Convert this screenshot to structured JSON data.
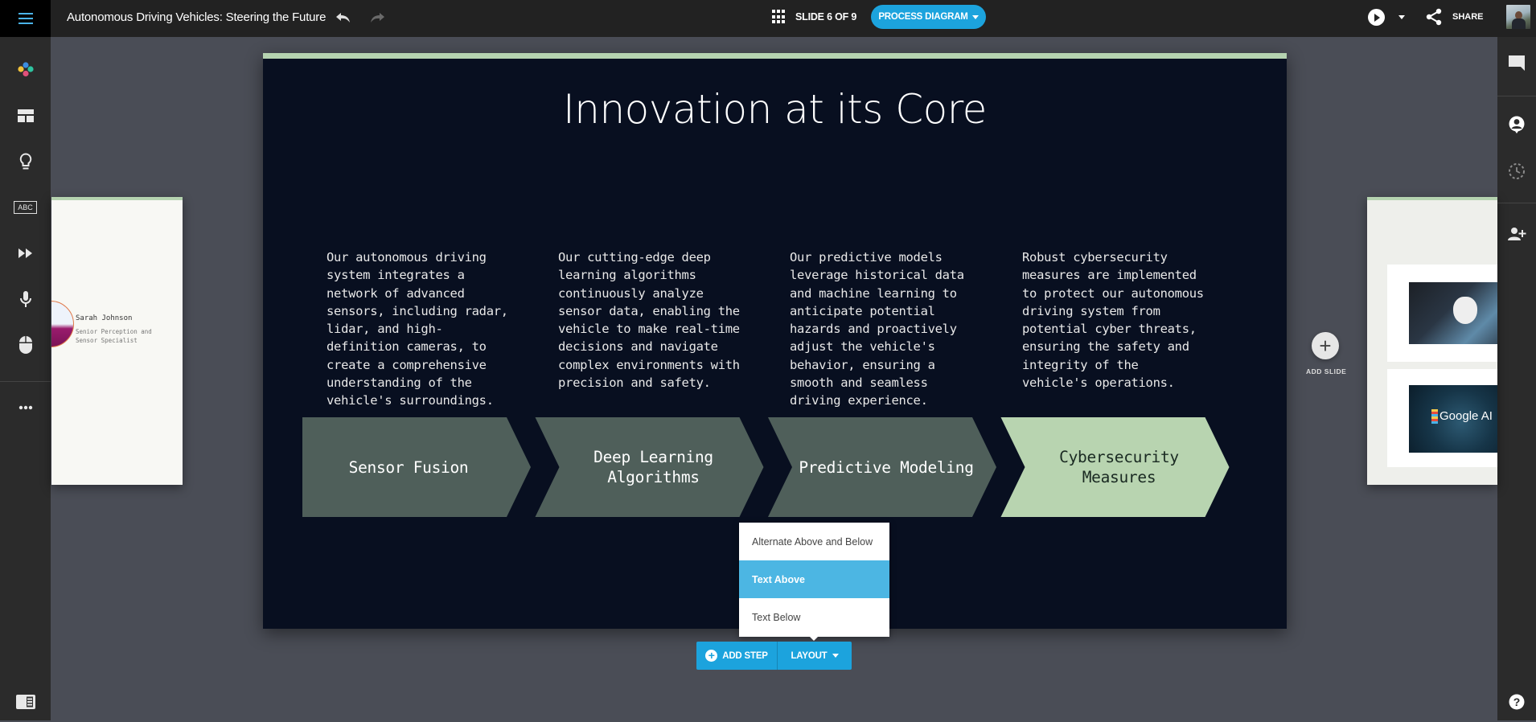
{
  "header": {
    "doc_title": "Autonomous Driving Vehicles: Steering the Future",
    "slide_counter": "SLIDE 6 OF 9",
    "slide_type": "PROCESS DIAGRAM",
    "share_label": "SHARE"
  },
  "left_toolbar": {
    "items": [
      {
        "icon": "palette-icon",
        "label": "Theme"
      },
      {
        "icon": "layout-icon",
        "label": "Layout"
      },
      {
        "icon": "lightbulb-icon",
        "label": "Ideas"
      },
      {
        "icon": "text-abc-icon",
        "label": "ABC"
      },
      {
        "icon": "animation-icon",
        "label": "Animation"
      },
      {
        "icon": "microphone-icon",
        "label": "Record"
      },
      {
        "icon": "mouse-icon",
        "label": "Interaction"
      },
      {
        "icon": "more-icon",
        "label": "More"
      }
    ],
    "bottom_icon": "panel-toggle-icon"
  },
  "right_toolbar": {
    "items": [
      "comment-icon",
      "account-icon",
      "history-icon",
      "add-user-icon"
    ],
    "bottom_icon": "help-icon"
  },
  "prev_slide": {
    "person_name": "Sarah Johnson",
    "person_role": "Senior Perception and Sensor Specialist"
  },
  "next_slide": {
    "image_2_text": "Google AI"
  },
  "add_slide_label": "ADD SLIDE",
  "slide": {
    "title": "Innovation at its Core",
    "accent_color": "#b5d3b0",
    "background_color": "#080f20",
    "steps": [
      {
        "label": "Sensor Fusion",
        "description": "Our autonomous driving system integrates a network of advanced sensors, including radar, lidar, and high-definition cameras, to create a comprehensive understanding of the vehicle's surroundings.",
        "fill": "#4f5f5a",
        "text_color": "#ffffff"
      },
      {
        "label": "Deep Learning Algorithms",
        "description": "Our cutting-edge deep learning algorithms continuously analyze sensor data, enabling the vehicle to make real-time decisions and navigate complex environments with precision and safety.",
        "fill": "#4f5f5a",
        "text_color": "#ffffff"
      },
      {
        "label": "Predictive Modeling",
        "description": "Our predictive models leverage historical data and machine learning to anticipate potential hazards and proactively adjust the vehicle's behavior, ensuring a smooth and seamless driving experience.",
        "fill": "#4f5f5a",
        "text_color": "#ffffff"
      },
      {
        "label": "Cybersecurity Measures",
        "description": "Robust cybersecurity measures are implemented to protect our autonomous driving system from potential cyber threats, ensuring the safety and integrity of the vehicle's operations.",
        "fill": "#b8d4b0",
        "text_color": "#1a2a22"
      }
    ]
  },
  "layout_menu": {
    "options": [
      "Alternate Above and Below",
      "Text Above",
      "Text Below"
    ],
    "selected": "Text Above"
  },
  "bottom_toolbar": {
    "add_step_label": "ADD STEP",
    "layout_label": "LAYOUT"
  }
}
